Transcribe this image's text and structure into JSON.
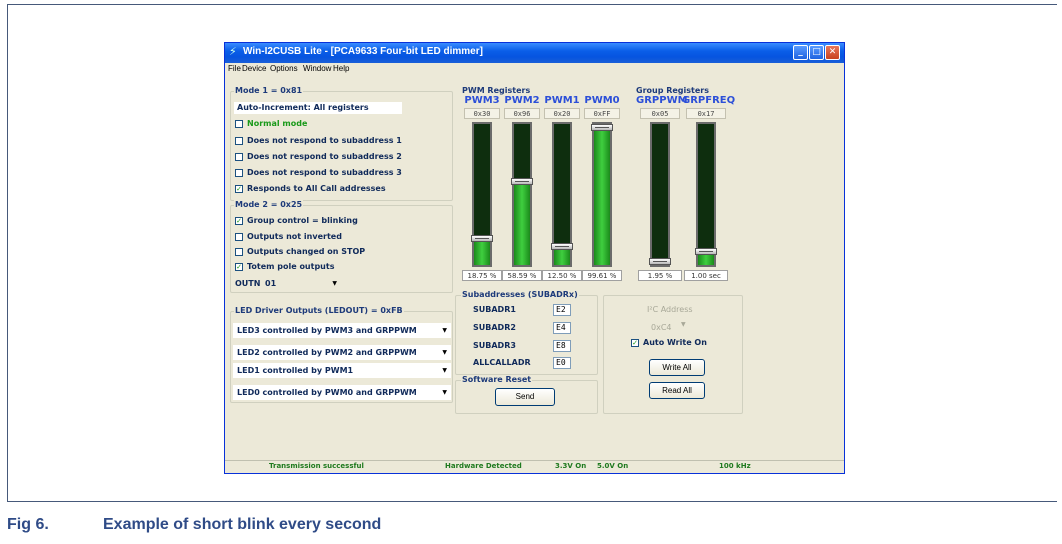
{
  "window": {
    "title": "Win-I2CUSB Lite - [PCA9633 Four-bit LED dimmer]",
    "menu": [
      "File",
      "Device",
      "Options",
      "Window",
      "Help"
    ],
    "min": "_",
    "max": "□",
    "close": "✕"
  },
  "mode1": {
    "title": "Mode 1 = 0x81",
    "auto_increment": "Auto-Increment: All registers",
    "options": [
      {
        "label": "Normal mode",
        "checked": false
      },
      {
        "label": "Does not respond to subaddress 1",
        "checked": false
      },
      {
        "label": "Does not respond to subaddress 2",
        "checked": false
      },
      {
        "label": "Does not respond to subaddress 3",
        "checked": false
      },
      {
        "label": "Responds to All Call addresses",
        "checked": true
      }
    ]
  },
  "mode2": {
    "title": "Mode 2 = 0x25",
    "options": [
      {
        "label": "Group control = blinking",
        "checked": true
      },
      {
        "label": "Outputs not inverted",
        "checked": false
      },
      {
        "label": "Outputs changed on STOP",
        "checked": false
      },
      {
        "label": "Totem pole outputs",
        "checked": true
      }
    ],
    "outne_label": "OUTNE",
    "outne_value": "01"
  },
  "ledout": {
    "title": "LED Driver Outputs (LEDOUT) = 0xFB",
    "items": [
      "LED3 controlled by PWM3 and GRPPWM",
      "LED2 controlled by PWM2 and GRPPWM",
      "LED1 controlled by PWM1",
      "LED0 controlled by PWM0 and GRPPWM"
    ]
  },
  "pwm": {
    "title": "PWM Registers",
    "channels": [
      {
        "name": "PWM3",
        "hex": "0x30",
        "level": 0.1875,
        "pct": "18.75 %"
      },
      {
        "name": "PWM2",
        "hex": "0x96",
        "level": 0.5859,
        "pct": "58.59 %"
      },
      {
        "name": "PWM1",
        "hex": "0x20",
        "level": 0.125,
        "pct": "12.50 %"
      },
      {
        "name": "PWM0",
        "hex": "0xFF",
        "level": 0.9961,
        "pct": "99.61 %"
      }
    ]
  },
  "group": {
    "title": "Group Registers",
    "channels": [
      {
        "name": "GRPPWM",
        "hex": "0x05",
        "level": 0.0195,
        "pct": "1.95 %"
      },
      {
        "name": "GRPFREQ",
        "hex": "0x17",
        "level": 0.09,
        "pct": "1.00 sec"
      }
    ]
  },
  "subaddr": {
    "title": "Subaddresses (SUBADRx)",
    "rows": [
      {
        "label": "SUBADR1",
        "value": "E2"
      },
      {
        "label": "SUBADR2",
        "value": "E4"
      },
      {
        "label": "SUBADR3",
        "value": "E8"
      },
      {
        "label": "ALLCALLADR",
        "value": "E0"
      }
    ]
  },
  "reset": {
    "title": "Software Reset",
    "send": "Send"
  },
  "i2c": {
    "address_label": "I²C Address",
    "address_value": "0xC4",
    "auto_write": "Auto Write On",
    "auto_write_checked": true,
    "write_all": "Write All",
    "read_all": "Read All"
  },
  "status": {
    "message": "Transmission successful",
    "hardware": "Hardware Detected",
    "v33": "3.3V On",
    "v50": "5.0V On",
    "freq": "100 kHz"
  },
  "caption": {
    "fig": "Fig 6.",
    "text": "Example of short blink every second"
  }
}
